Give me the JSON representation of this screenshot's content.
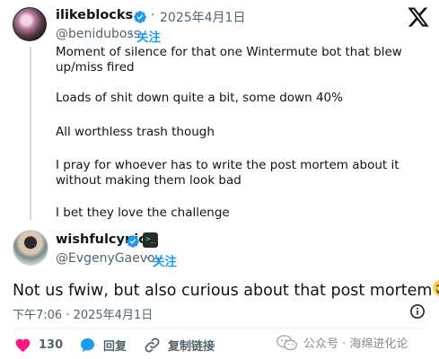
{
  "quoted_tweet": {
    "display_name": "ilikeblocks",
    "date": "2025年4月1日",
    "separator": "·",
    "handle": "@beniduboss",
    "follow_label": "关注",
    "paragraphs": [
      "Moment of silence for that one Wintermute bot that blew up/miss fired",
      "Loads of shit down quite a bit, some down 40%",
      "All worthless trash though",
      "I pray for whoever has to write the post mortem about it without making them look bad",
      "I bet they love the challenge"
    ]
  },
  "main_tweet": {
    "display_name": "wishfulcynic",
    "handle": "@EvgenyGaevoy",
    "separator": "·",
    "follow_label": "关注",
    "text": "Not us fwiw, but also curious about that post mortem",
    "timestamp": "下午7:06 · 2025年4月1日"
  },
  "actions": {
    "like_count": "130",
    "reply_label": "回复",
    "copy_link_label": "复制链接"
  },
  "watermark": {
    "text": "公众号 · 海绵进化论"
  },
  "icons": {
    "verified": "verified-badge-icon",
    "x_logo": "x-logo-icon",
    "info": "info-icon",
    "heart": "heart-icon",
    "reply": "reply-bubble-icon",
    "link": "link-icon",
    "emoji": "sweat-smile-emoji-icon"
  },
  "colors": {
    "accent": "#1d9bf0",
    "like": "#f91880",
    "secondary_text": "#536471",
    "primary_text": "#0f1419"
  }
}
